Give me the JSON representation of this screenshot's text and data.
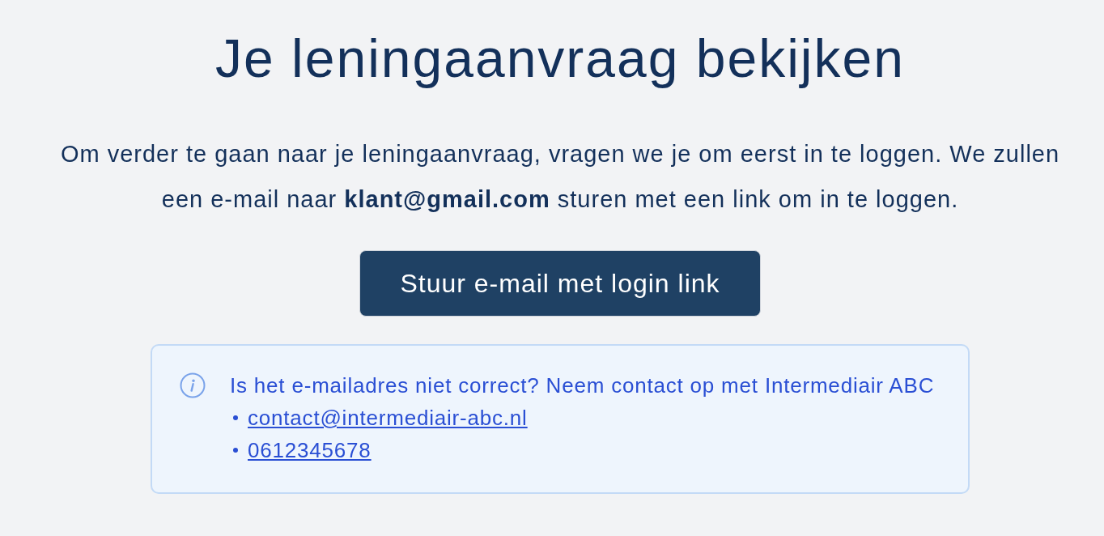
{
  "heading": "Je leningaanvraag bekijken",
  "intro": "Om verder te gaan naar je leningaanvraag, vragen we je om eerst in te loggen. We zullen een e-mail naar **klant@gmail.com** sturen met een link om in te loggen.",
  "button": {
    "label": "Stuur e-mail met login link"
  },
  "notice": {
    "message": "Is het e-mailadres niet correct? Neem contact op met Intermediair ABC",
    "contacts": [
      {
        "label": "contact@intermediair-abc.nl"
      },
      {
        "label": "0612345678"
      }
    ]
  }
}
